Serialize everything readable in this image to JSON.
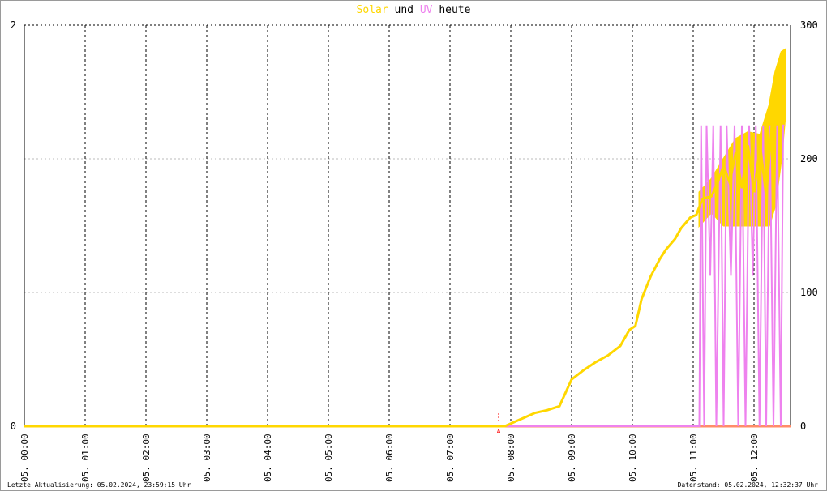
{
  "header": {
    "title_solar": "Solar",
    "title_und": "und",
    "title_uv": "UV",
    "title_heute": "heute"
  },
  "footer": {
    "left": "Letzte Aktualisierung: 05.02.2024, 23:59:15 Uhr",
    "right": "Datenstand: 05.02.2024, 12:32:37 Uhr"
  },
  "colors": {
    "solar": "#FFD700",
    "uv": "#EE82EE",
    "zero_line": "#FF8C69",
    "sunrise": "#FF0000"
  },
  "chart_data": {
    "type": "line",
    "x_unit": "hours since 05. 00:00",
    "xlim": [
      0,
      12.6
    ],
    "x_ticks": [
      0,
      1,
      2,
      3,
      4,
      5,
      6,
      7,
      8,
      9,
      10,
      11,
      12
    ],
    "x_tick_labels": [
      "05. 00:00",
      "05. 01:00",
      "05. 02:00",
      "05. 03:00",
      "05. 04:00",
      "05. 05:00",
      "05. 06:00",
      "05. 07:00",
      "05. 08:00",
      "05. 09:00",
      "05. 10:00",
      "05. 11:00",
      "05. 12:00"
    ],
    "y_left": {
      "lim": [
        0,
        2
      ],
      "ticks": [
        0,
        2
      ]
    },
    "y_right": {
      "lim": [
        0,
        300
      ],
      "ticks": [
        0,
        100,
        200,
        300
      ]
    },
    "sunrise_marker": {
      "x": 7.8,
      "label": "A"
    },
    "series": [
      {
        "name": "Solar",
        "axis": "right",
        "points": [
          [
            0,
            0
          ],
          [
            7.9,
            0
          ],
          [
            8.0,
            2
          ],
          [
            8.2,
            6
          ],
          [
            8.4,
            10
          ],
          [
            8.6,
            12
          ],
          [
            8.8,
            15
          ],
          [
            9.0,
            35
          ],
          [
            9.2,
            42
          ],
          [
            9.4,
            48
          ],
          [
            9.6,
            53
          ],
          [
            9.8,
            60
          ],
          [
            9.95,
            72
          ],
          [
            10.05,
            75
          ],
          [
            10.15,
            95
          ],
          [
            10.3,
            112
          ],
          [
            10.45,
            125
          ],
          [
            10.55,
            132
          ],
          [
            10.7,
            140
          ],
          [
            10.8,
            148
          ],
          [
            10.95,
            156
          ],
          [
            11.05,
            158
          ],
          [
            11.15,
            170
          ],
          [
            11.3,
            172
          ],
          [
            11.4,
            182
          ],
          [
            11.5,
            195
          ],
          [
            11.6,
            182
          ],
          [
            11.7,
            205
          ],
          [
            11.8,
            178
          ],
          [
            11.9,
            210
          ],
          [
            12.0,
            175
          ],
          [
            12.1,
            210
          ],
          [
            12.2,
            172
          ],
          [
            12.3,
            230
          ],
          [
            12.4,
            255
          ],
          [
            12.48,
            270
          ]
        ],
        "band": [
          [
            11.1,
            150,
            175
          ],
          [
            11.3,
            160,
            185
          ],
          [
            11.5,
            150,
            200
          ],
          [
            11.7,
            150,
            215
          ],
          [
            11.9,
            150,
            220
          ],
          [
            12.1,
            150,
            218
          ],
          [
            12.25,
            150,
            240
          ],
          [
            12.35,
            165,
            265
          ],
          [
            12.45,
            200,
            280
          ],
          [
            12.52,
            235,
            282
          ]
        ]
      },
      {
        "name": "UV",
        "axis": "left",
        "points": [
          [
            0,
            0
          ],
          [
            11.1,
            0
          ],
          [
            11.13,
            1.5
          ],
          [
            11.18,
            0
          ],
          [
            11.22,
            1.5
          ],
          [
            11.28,
            0.75
          ],
          [
            11.33,
            1.5
          ],
          [
            11.38,
            0
          ],
          [
            11.45,
            1.5
          ],
          [
            11.5,
            0
          ],
          [
            11.55,
            1.5
          ],
          [
            11.62,
            0.75
          ],
          [
            11.68,
            1.5
          ],
          [
            11.74,
            0
          ],
          [
            11.8,
            1.5
          ],
          [
            11.86,
            0
          ],
          [
            11.92,
            1.5
          ],
          [
            11.98,
            0.75
          ],
          [
            12.03,
            1.5
          ],
          [
            12.09,
            0
          ],
          [
            12.15,
            1.5
          ],
          [
            12.2,
            0
          ],
          [
            12.26,
            1.5
          ],
          [
            12.32,
            0
          ],
          [
            12.38,
            1.5
          ],
          [
            12.44,
            0
          ],
          [
            12.48,
            1.5
          ],
          [
            12.5,
            1.5
          ]
        ]
      }
    ]
  }
}
